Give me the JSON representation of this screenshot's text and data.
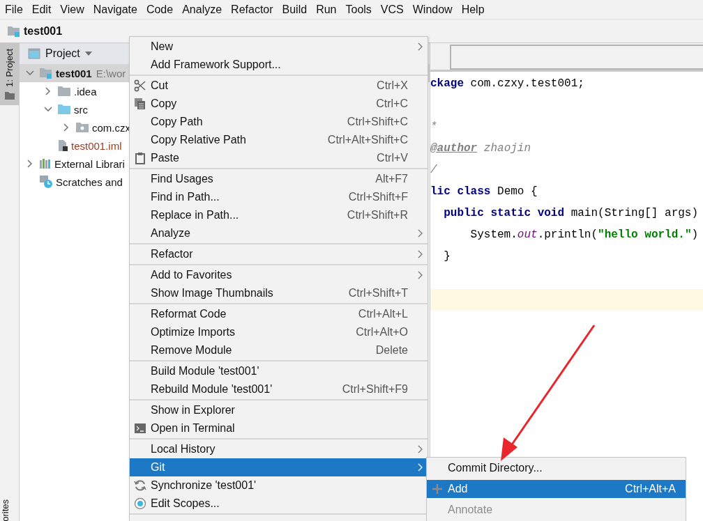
{
  "menu_bar": [
    "File",
    "Edit",
    "View",
    "Navigate",
    "Code",
    "Analyze",
    "Refactor",
    "Build",
    "Run",
    "Tools",
    "VCS",
    "Window",
    "Help"
  ],
  "breadcrumb": {
    "label": "test001"
  },
  "left_strip": {
    "tabs": [
      {
        "label": "1: Project",
        "selected": true
      }
    ],
    "bottom_label": "orites"
  },
  "project_panel": {
    "title": "Project",
    "tree": [
      {
        "label": "test001",
        "hint": "E:\\wor",
        "kind": "module",
        "expanded": true,
        "selected": true,
        "children": [
          {
            "label": ".idea",
            "kind": "folder",
            "expanded": false,
            "selected": false
          },
          {
            "label": "src",
            "kind": "source-folder",
            "expanded": true,
            "selected": false,
            "children": [
              {
                "label": "com.czx",
                "kind": "package",
                "expanded": false,
                "selected": false
              }
            ]
          },
          {
            "label": "test001.iml",
            "kind": "file",
            "selected": false
          }
        ]
      },
      {
        "label": "External Librari",
        "kind": "library",
        "expanded": false,
        "selected": false
      },
      {
        "label": "Scratches and",
        "kind": "scratches",
        "selected": false
      }
    ]
  },
  "editor": {
    "lines": [
      {
        "current": false,
        "tokens": [
          {
            "text": "ckage",
            "kind": "keyword"
          },
          {
            "text": " com.czxy.test001;",
            "kind": "plain"
          }
        ]
      },
      {
        "current": false
      },
      {
        "current": false,
        "tokens": [
          {
            "text": "*",
            "kind": "comment"
          }
        ]
      },
      {
        "current": false,
        "tokens": [
          {
            "text": "@author",
            "kind": "tag"
          },
          {
            "text": " zhaojin",
            "kind": "comment"
          }
        ]
      },
      {
        "current": false,
        "tokens": [
          {
            "text": "/",
            "kind": "comment"
          }
        ]
      },
      {
        "current": false,
        "tokens": [
          {
            "text": "lic class",
            "kind": "keyword"
          },
          {
            "text": " Demo {",
            "kind": "plain"
          }
        ]
      },
      {
        "current": false,
        "tokens": [
          {
            "text": "  public static void",
            "kind": "keyword"
          },
          {
            "text": " main(String[] args)",
            "kind": "plain"
          }
        ]
      },
      {
        "current": false,
        "tokens": [
          {
            "text": "      System.",
            "kind": "plain"
          },
          {
            "text": "out",
            "kind": "static"
          },
          {
            "text": ".println(",
            "kind": "plain"
          },
          {
            "text": "\"hello world.\"",
            "kind": "string"
          },
          {
            "text": ")",
            "kind": "plain"
          }
        ]
      },
      {
        "current": false,
        "tokens": [
          {
            "text": "  }",
            "kind": "plain"
          }
        ]
      },
      {
        "current": false
      },
      {
        "current": true
      }
    ]
  },
  "context_menu": {
    "groups": [
      {
        "items": [
          {
            "label": "New",
            "submenu": true,
            "selected": false
          },
          {
            "label": "Add Framework Support...",
            "selected": false
          }
        ]
      },
      {
        "items": [
          {
            "label": "Cut",
            "shortcut": "Ctrl+X",
            "kind": "cut",
            "selected": false
          },
          {
            "label": "Copy",
            "shortcut": "Ctrl+C",
            "kind": "copy",
            "selected": false
          },
          {
            "label": "Copy Path",
            "shortcut": "Ctrl+Shift+C",
            "selected": false
          },
          {
            "label": "Copy Relative Path",
            "shortcut": "Ctrl+Alt+Shift+C",
            "selected": false
          },
          {
            "label": "Paste",
            "shortcut": "Ctrl+V",
            "kind": "paste",
            "selected": false
          }
        ]
      },
      {
        "items": [
          {
            "label": "Find Usages",
            "shortcut": "Alt+F7",
            "selected": false
          },
          {
            "label": "Find in Path...",
            "shortcut": "Ctrl+Shift+F",
            "selected": false
          },
          {
            "label": "Replace in Path...",
            "shortcut": "Ctrl+Shift+R",
            "selected": false
          },
          {
            "label": "Analyze",
            "submenu": true,
            "selected": false
          }
        ]
      },
      {
        "items": [
          {
            "label": "Refactor",
            "submenu": true,
            "selected": false
          }
        ]
      },
      {
        "items": [
          {
            "label": "Add to Favorites",
            "submenu": true,
            "selected": false
          },
          {
            "label": "Show Image Thumbnails",
            "shortcut": "Ctrl+Shift+T",
            "selected": false
          }
        ]
      },
      {
        "items": [
          {
            "label": "Reformat Code",
            "shortcut": "Ctrl+Alt+L",
            "selected": false
          },
          {
            "label": "Optimize Imports",
            "shortcut": "Ctrl+Alt+O",
            "selected": false
          },
          {
            "label": "Remove Module",
            "shortcut": "Delete",
            "selected": false
          }
        ]
      },
      {
        "items": [
          {
            "label": "Build Module 'test001'",
            "selected": false
          },
          {
            "label": "Rebuild Module 'test001'",
            "shortcut": "Ctrl+Shift+F9",
            "selected": false
          }
        ]
      },
      {
        "items": [
          {
            "label": "Show in Explorer",
            "selected": false
          },
          {
            "label": "Open in Terminal",
            "kind": "terminal",
            "selected": false
          }
        ]
      },
      {
        "items": [
          {
            "label": "Local History",
            "submenu": true,
            "selected": false
          },
          {
            "label": "Git",
            "submenu": true,
            "selected": true
          },
          {
            "label": "Synchronize 'test001'",
            "kind": "sync",
            "selected": false
          },
          {
            "label": "Edit Scopes...",
            "kind": "scope",
            "selected": false
          }
        ]
      }
    ]
  },
  "git_submenu": {
    "items": [
      {
        "label": "Commit Directory...",
        "selected": false,
        "disabled": false
      },
      {
        "label": "Add",
        "shortcut": "Ctrl+Alt+A",
        "kind": "add",
        "selected": true,
        "disabled": false
      },
      {
        "label": "Annotate",
        "selected": false,
        "disabled": true
      }
    ]
  }
}
